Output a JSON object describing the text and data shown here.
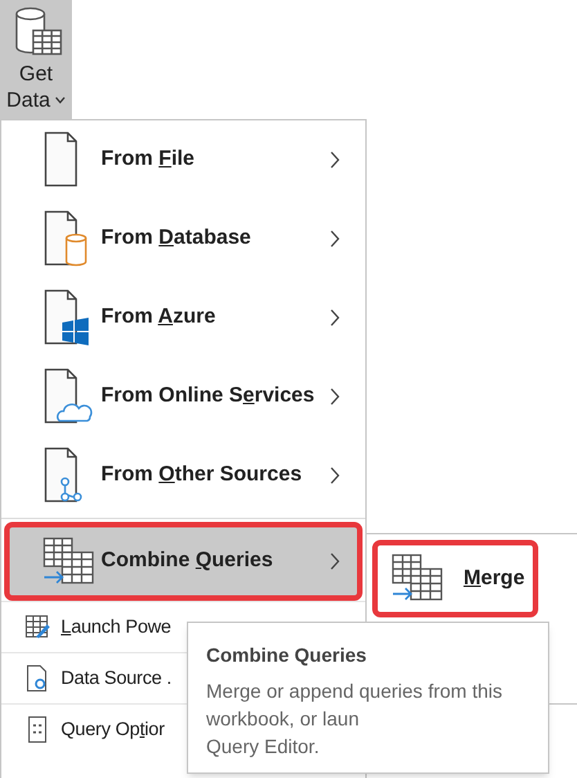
{
  "ribbon_button": {
    "label_lines": [
      "Get",
      "Data"
    ],
    "expanded": true
  },
  "menu": {
    "items": [
      {
        "kind": "source",
        "label": {
          "before": "From ",
          "key": "F",
          "after": "ile"
        },
        "highlighted": false,
        "outlined": false
      },
      {
        "kind": "source",
        "label": {
          "before": "From ",
          "key": "D",
          "after": "atabase"
        },
        "highlighted": false,
        "outlined": false
      },
      {
        "kind": "source",
        "label": {
          "before": "From ",
          "key": "A",
          "after": "zure"
        },
        "highlighted": false,
        "outlined": false
      },
      {
        "kind": "source",
        "label": {
          "before": "From Online S",
          "key": "e",
          "after": "rvices"
        },
        "highlighted": false,
        "outlined": false
      },
      {
        "kind": "source",
        "label": {
          "before": "From ",
          "key": "O",
          "after": "ther Sources"
        },
        "highlighted": false,
        "outlined": false
      },
      {
        "kind": "combine",
        "label": {
          "before": "Combine ",
          "key": "Q",
          "after": "ueries"
        },
        "highlighted": true,
        "outlined": true
      },
      {
        "kind": "small",
        "label": {
          "key": "L",
          "after": "aunch Powe"
        }
      },
      {
        "kind": "small",
        "label": {
          "before": "Data Source ."
        }
      },
      {
        "kind": "small",
        "label": {
          "before": "Query Op",
          "key": "t",
          "after": "ior"
        }
      }
    ]
  },
  "submenu": {
    "items": [
      {
        "label": {
          "key": "M",
          "after": "erge"
        },
        "outlined": true
      }
    ]
  },
  "tooltip": {
    "title": "Combine Queries",
    "description_lines": [
      "Merge or append queries from this",
      "workbook, or laun",
      "Query Editor."
    ]
  }
}
